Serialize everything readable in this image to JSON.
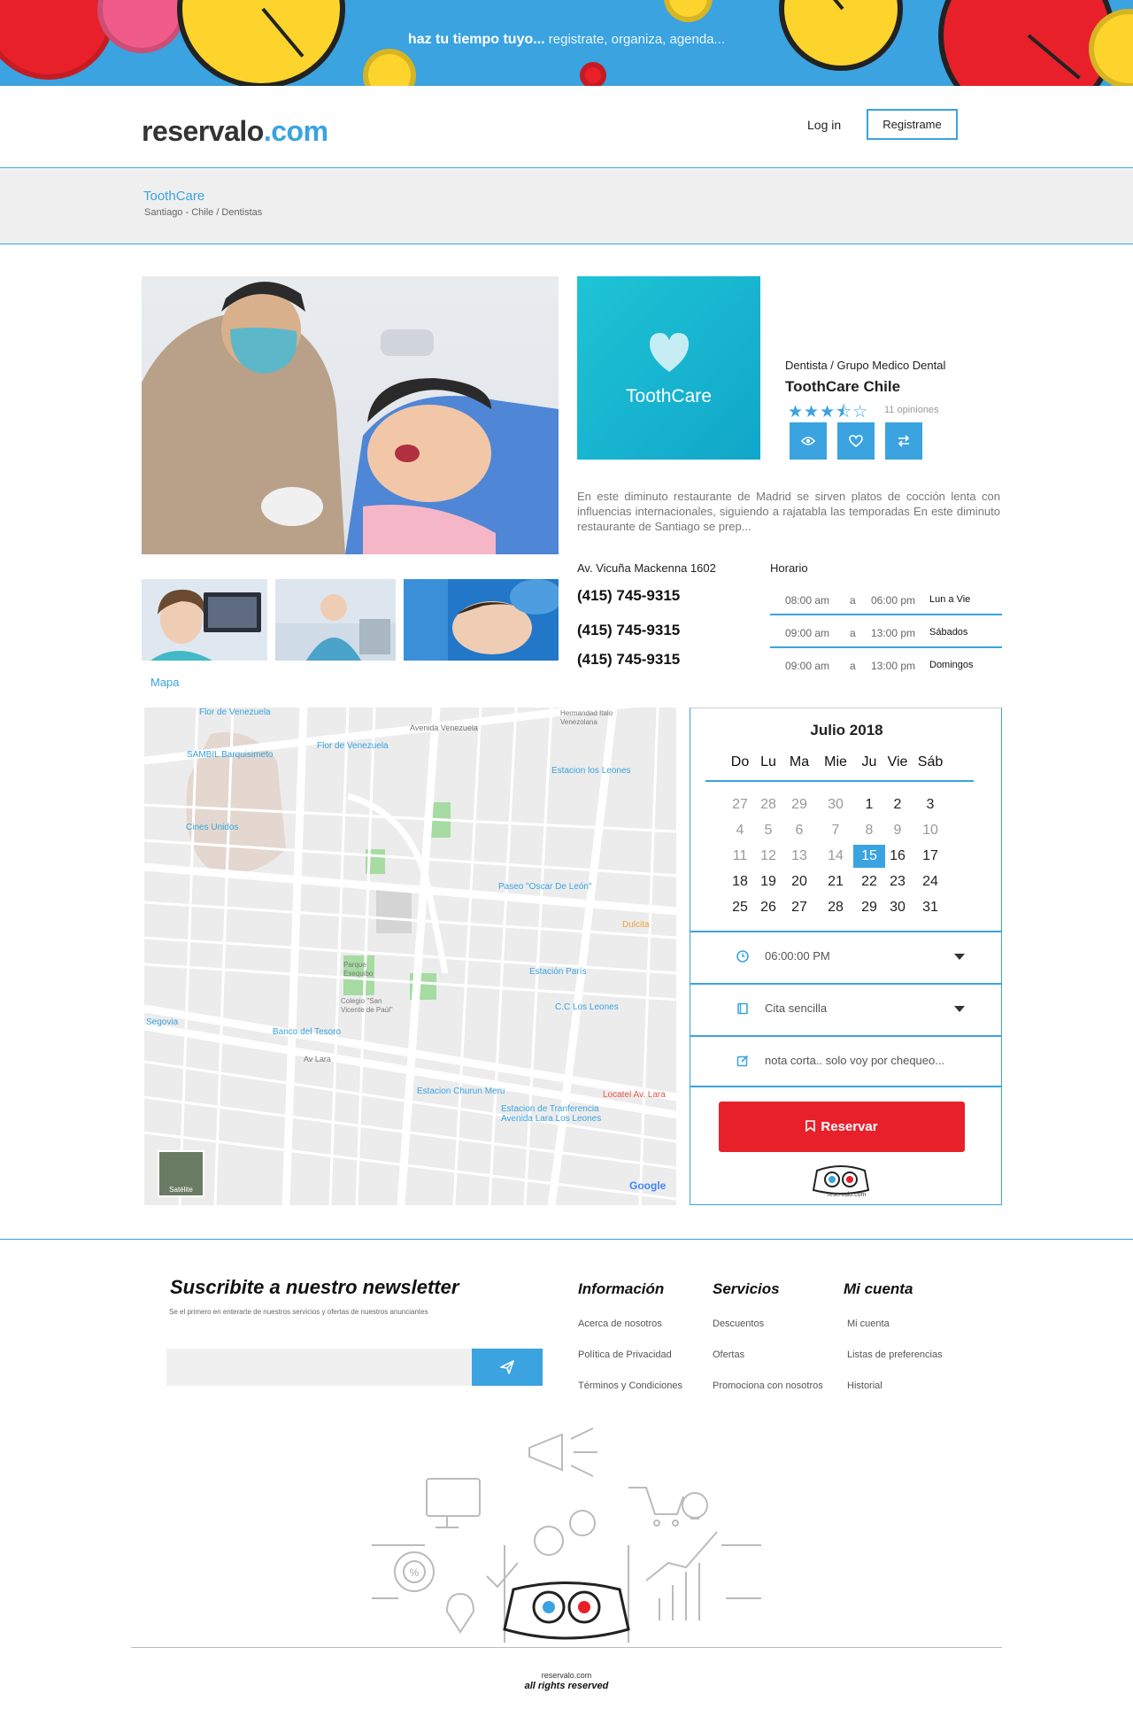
{
  "banner": {
    "tagline_bold": "haz tu tiempo tuyo...",
    "tagline_rest": " registrate, organiza, agenda..."
  },
  "header": {
    "logo_main": "reservalo",
    "logo_tld": ".com",
    "login_label": "Log in",
    "register_label": "Registrame"
  },
  "breadcrumb": {
    "title": "ToothCare",
    "path": "Santiago - Chile / Dentistas"
  },
  "business": {
    "brand_logo_text": "ToothCare",
    "category": "Dentista / Grupo Medico Dental",
    "name": "ToothCare Chile",
    "rating": 3.5,
    "rating_max": 5,
    "reviews_label": "11 opiniones",
    "actions": [
      "eye-icon",
      "heart-icon",
      "swap-icon"
    ],
    "description": "En este diminuto restaurante de Madrid se sirven platos de cocción lenta con influencias internacionales, siguiendo a rajatabla las temporadas En este diminuto restaurante de Santiago se prep...",
    "address": "Av. Vicuña Mackenna 1602",
    "phones": [
      "(415) 745-9315",
      "(415) 745-9315",
      "(415) 745-9315"
    ],
    "schedule_label": "Horario",
    "schedule": [
      {
        "open": "08:00 am",
        "sep": "a",
        "close": "06:00 pm",
        "days": "Lun a Vie"
      },
      {
        "open": "09:00 am",
        "sep": "a",
        "close": "13:00 pm",
        "days": "Sábados"
      },
      {
        "open": "09:00 am",
        "sep": "a",
        "close": "13:00 pm",
        "days": "Domingos"
      }
    ],
    "map_label": "Mapa"
  },
  "map": {
    "labels": [
      "Flor de Venezuela",
      "Avenida Venezuela",
      "Hermandad Italo Venezolana",
      "SAMBIL Barquisimeto",
      "Estacion los Leones",
      "Cines Unidos",
      "Paseo \"Oscar De León\"",
      "Dulcita",
      "Parque Esequibo",
      "Estación París",
      "Colegio \"San Vicente de Paúl\"",
      "C.C Los Leones",
      "Segovia",
      "Banco del Tesoro",
      "Av Lara",
      "Estacion Churun Meru",
      "Estacion de Tranferencia Avenida Lara Los Leones",
      "Locatel Av. Lara"
    ],
    "satellite_label": "Satélite",
    "attribution": "Google"
  },
  "calendar": {
    "title": "Julio 2018",
    "weekdays": [
      "Do",
      "Lu",
      "Ma",
      "Mie",
      "Ju",
      "Vie",
      "Sáb"
    ],
    "weeks": [
      [
        "27",
        "28",
        "29",
        "30",
        "1",
        "2",
        "3"
      ],
      [
        "4",
        "5",
        "6",
        "7",
        "8",
        "9",
        "10"
      ],
      [
        "11",
        "12",
        "13",
        "14",
        "15",
        "16",
        "17"
      ],
      [
        "18",
        "19",
        "20",
        "21",
        "22",
        "23",
        "24"
      ],
      [
        "25",
        "26",
        "27",
        "28",
        "29",
        "30",
        "31"
      ]
    ],
    "selected": "15"
  },
  "booking": {
    "time_value": "06:00:00 PM",
    "type_value": "Cita sencilla",
    "note_value": "nota corta.. solo voy por chequeo...",
    "reserve_label": "Reservar",
    "brand_small": "reservalo.com"
  },
  "footer": {
    "newsletter_title": "Suscribite a nuestro newsletter",
    "newsletter_sub": "Se el primero en enterarte de nuestros servicios y ofertas de nuestros anunciantes",
    "newsletter_placeholder": "",
    "columns": [
      {
        "title": "Información",
        "links": [
          "Acerca de nosotros",
          "Política de Privacidad",
          "Términos y Condiciones"
        ]
      },
      {
        "title": "Servicios",
        "links": [
          "Descuentos",
          "Ofertas",
          "Promociona con nosotros"
        ]
      },
      {
        "title": "Mi cuenta",
        "links": [
          "Mi cuenta",
          "Listas de preferencias",
          "Historial"
        ]
      }
    ],
    "site": "reservalo.com",
    "rights": "all rights reserved"
  },
  "colors": {
    "accent": "#3aa3e0",
    "reserve": "#e8202a",
    "brand_card": "#15b3cf"
  }
}
